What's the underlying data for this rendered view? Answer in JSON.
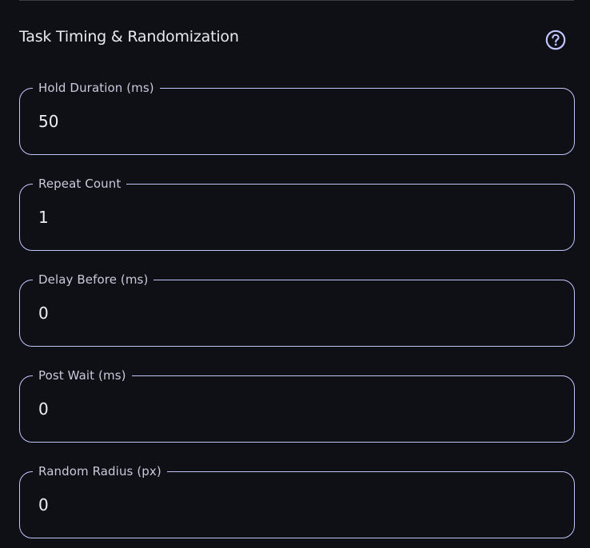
{
  "section": {
    "title": "Task Timing & Randomization",
    "help_icon": "help-circle-icon"
  },
  "fields": [
    {
      "label": "Hold Duration (ms)",
      "value": "50"
    },
    {
      "label": "Repeat Count",
      "value": "1"
    },
    {
      "label": "Delay Before (ms)",
      "value": "0"
    },
    {
      "label": "Post Wait (ms)",
      "value": "0"
    },
    {
      "label": "Random Radius (px)",
      "value": "0"
    }
  ],
  "colors": {
    "background": "#0e1015",
    "outline": "#c3c5ff",
    "text": "#e6e7ee"
  }
}
